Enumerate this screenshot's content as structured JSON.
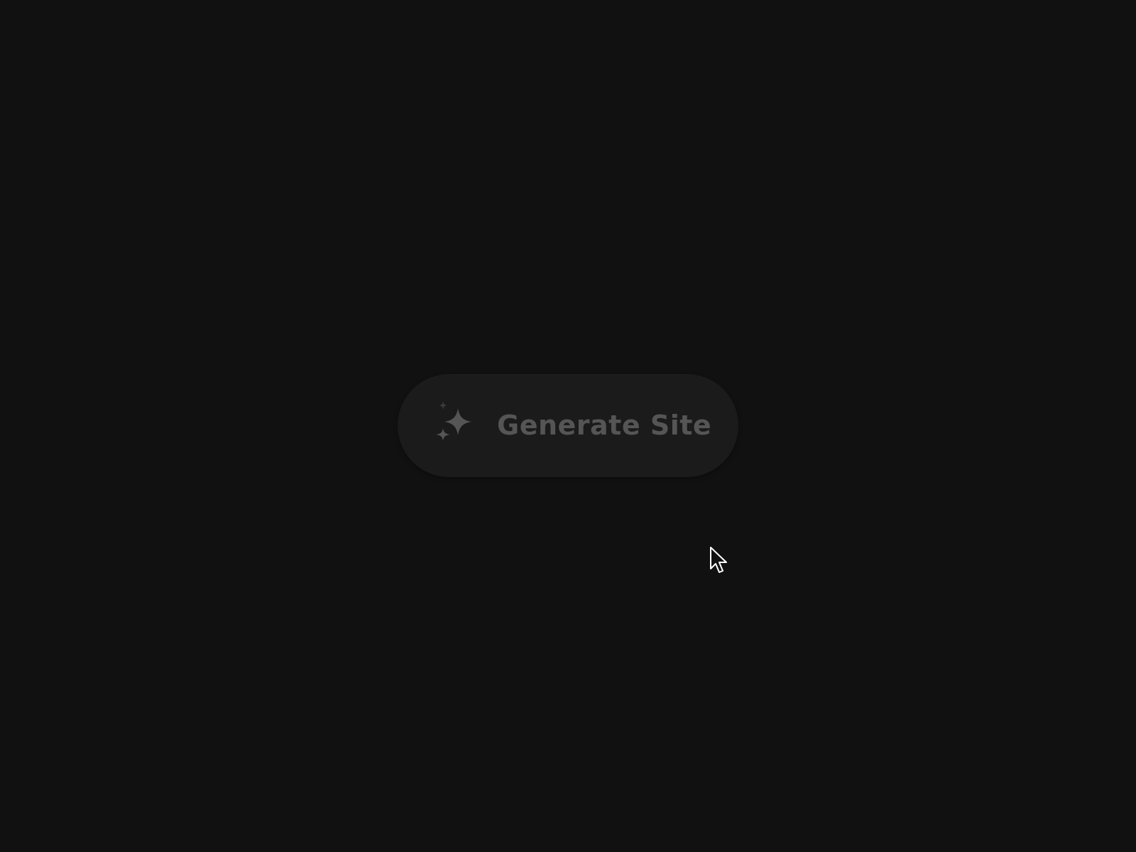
{
  "page": {
    "background": "#111111"
  },
  "generate_button": {
    "label": "Generate Site",
    "icon": "sparkles-icon",
    "background": "#1b1b1b",
    "text_color": "#555555",
    "icon_color": "#555555"
  },
  "cursor": {
    "icon": "mouse-pointer-icon"
  }
}
